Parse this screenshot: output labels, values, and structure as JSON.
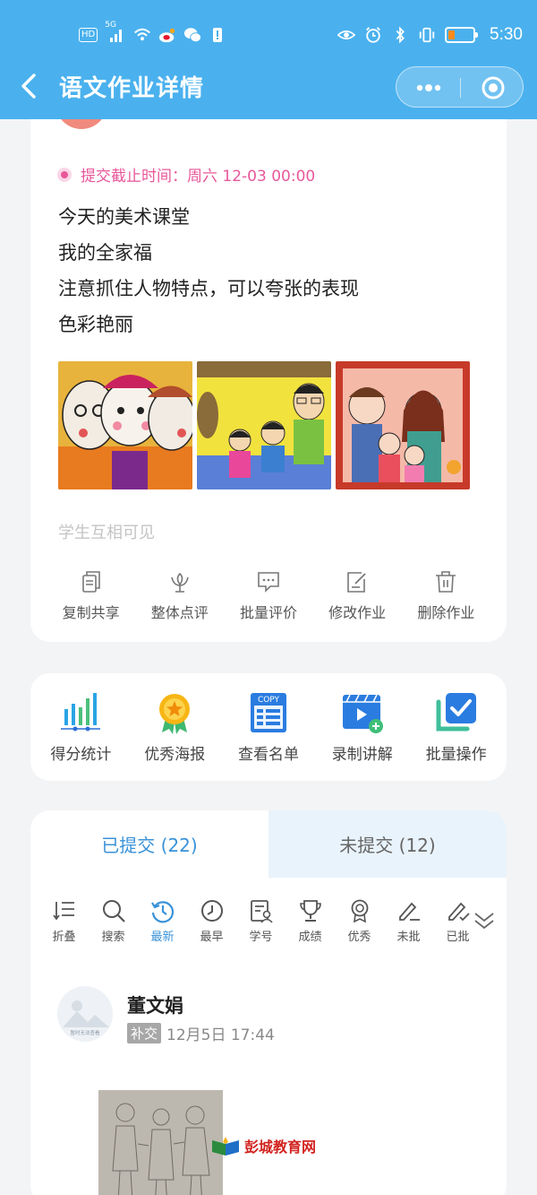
{
  "status_bar": {
    "network_label": "HD",
    "signal_label": "5G",
    "time": "5:30",
    "battery_level": 0.25,
    "battery_color": "#ff8a1c"
  },
  "header": {
    "title": "语文作业详情",
    "background_color": "#4ab1ee"
  },
  "assignment": {
    "deadline": "提交截止时间：周六 12-03 00:00",
    "content_lines": [
      "今天的美术课堂",
      "我的全家福",
      "注意抓住人物特点，可以夸张的表现",
      "色彩艳丽"
    ],
    "visibility": "学生互相可见",
    "actions": [
      {
        "label": "复制共享",
        "icon": "copy-icon"
      },
      {
        "label": "整体点评",
        "icon": "flower-icon"
      },
      {
        "label": "批量评价",
        "icon": "comment-icon"
      },
      {
        "label": "修改作业",
        "icon": "edit-icon"
      },
      {
        "label": "删除作业",
        "icon": "trash-icon"
      }
    ]
  },
  "tools": [
    {
      "label": "得分统计",
      "icon": "bar-chart-icon"
    },
    {
      "label": "优秀海报",
      "icon": "medal-icon"
    },
    {
      "label": "查看名单",
      "icon": "copy-list-icon"
    },
    {
      "label": "录制讲解",
      "icon": "video-icon"
    },
    {
      "label": "批量操作",
      "icon": "checkbox-icon"
    }
  ],
  "submissions": {
    "tabs": [
      {
        "label": "已提交 (22)",
        "active": true
      },
      {
        "label": "未提交 (12)",
        "active": false
      }
    ],
    "filters": [
      {
        "label": "折叠",
        "icon": "collapse-icon"
      },
      {
        "label": "搜索",
        "icon": "search-icon"
      },
      {
        "label": "最新",
        "icon": "clock-back-icon",
        "active": true
      },
      {
        "label": "最早",
        "icon": "clock-icon"
      },
      {
        "label": "学号",
        "icon": "id-card-icon"
      },
      {
        "label": "成绩",
        "icon": "trophy-icon"
      },
      {
        "label": "优秀",
        "icon": "ribbon-icon"
      },
      {
        "label": "未批",
        "icon": "pen-icon"
      },
      {
        "label": "已批",
        "icon": "pen-check-icon"
      }
    ],
    "entry": {
      "name": "董文娟",
      "badge": "补交",
      "time": "12月5日 17:44",
      "avatar_caption": "暂时无法查看"
    }
  },
  "watermark": "彭城教育网",
  "accent_color": "#3a92d8"
}
